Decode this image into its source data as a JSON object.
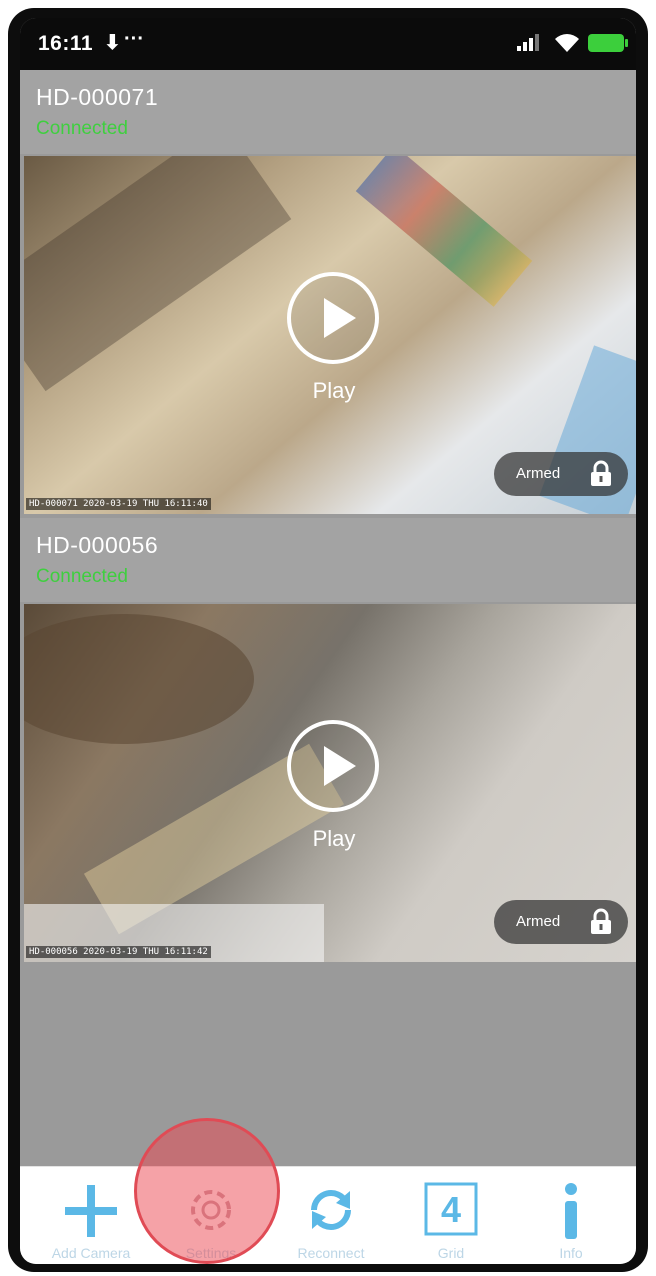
{
  "status_bar": {
    "time": "16:11",
    "extra_icon": "⬇",
    "dots": "···",
    "signal_icon": "signal-icon",
    "wifi_icon": "wifi-icon",
    "battery_icon": "battery-icon",
    "battery_color": "#3ccf3c"
  },
  "cameras": [
    {
      "name": "HD-000071",
      "status": "Connected",
      "play_label": "Play",
      "armed_label": "Armed",
      "stamp": "HD-000071 2020-03-19 THU 16:11:40"
    },
    {
      "name": "HD-000056",
      "status": "Connected",
      "play_label": "Play",
      "armed_label": "Armed",
      "stamp": "HD-000056 2020-03-19 THU 16:11:42"
    }
  ],
  "nav": {
    "add_camera": "Add Camera",
    "settings": "Settings",
    "reconnect": "Reconnect",
    "grid": "Grid",
    "grid_number": "4",
    "info": "Info"
  },
  "colors": {
    "accent": "#5bb8e6",
    "connected": "#3fcf3f",
    "highlight": "#e04b55"
  }
}
